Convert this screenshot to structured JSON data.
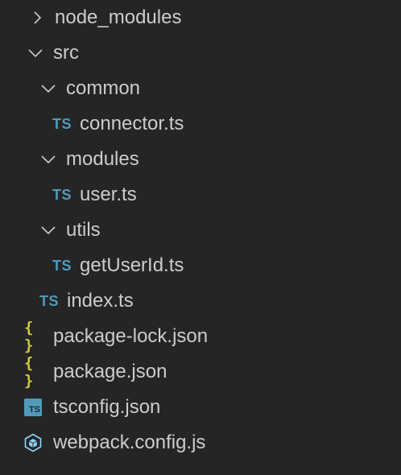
{
  "explorer": {
    "items": [
      {
        "label": "node_modules",
        "type": "folder",
        "expanded": false,
        "icon": "chevron-right-icon"
      },
      {
        "label": "src",
        "type": "folder",
        "expanded": true,
        "icon": "chevron-down-icon"
      },
      {
        "label": "common",
        "type": "folder",
        "expanded": true,
        "icon": "chevron-down-icon"
      },
      {
        "label": "connector.ts",
        "type": "file",
        "icon": "typescript-icon",
        "icon_text": "TS"
      },
      {
        "label": "modules",
        "type": "folder",
        "expanded": true,
        "icon": "chevron-down-icon"
      },
      {
        "label": "user.ts",
        "type": "file",
        "icon": "typescript-icon",
        "icon_text": "TS"
      },
      {
        "label": "utils",
        "type": "folder",
        "expanded": true,
        "icon": "chevron-down-icon"
      },
      {
        "label": "getUserId.ts",
        "type": "file",
        "icon": "typescript-icon",
        "icon_text": "TS"
      },
      {
        "label": "index.ts",
        "type": "file",
        "icon": "typescript-icon",
        "icon_text": "TS"
      },
      {
        "label": "package-lock.json",
        "type": "file",
        "icon": "json-icon",
        "icon_text": "{ }"
      },
      {
        "label": "package.json",
        "type": "file",
        "icon": "json-icon",
        "icon_text": "{ }"
      },
      {
        "label": "tsconfig.json",
        "type": "file",
        "icon": "tsconfig-icon",
        "icon_text": "TS"
      },
      {
        "label": "webpack.config.js",
        "type": "file",
        "icon": "webpack-icon"
      }
    ]
  },
  "colors": {
    "background": "#252526",
    "text": "#cccccc",
    "typescript": "#519aba",
    "json": "#cbcb41",
    "webpack": "#8ed6fb"
  }
}
